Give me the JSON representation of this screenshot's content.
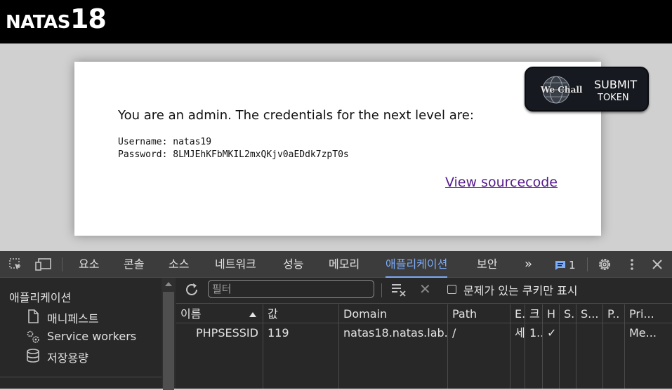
{
  "page": {
    "brand_text": "NATAS",
    "brand_num": "18",
    "message": "You are an admin. The credentials for the next level are:",
    "username_line": "Username: natas19",
    "password_line": "Password: 8LMJEhKFbMKIL2mxQKjv0aEDdk7zpT0s",
    "source_link": "View sourcecode",
    "submit_token": {
      "logo_text": "We Chall",
      "line1": "SUBMIT",
      "line2": "TOKEN"
    }
  },
  "devtools": {
    "tabs": [
      "요소",
      "콘솔",
      "소스",
      "네트워크",
      "성능",
      "메모리",
      "애플리케이션",
      "보안"
    ],
    "active_tab": "애플리케이션",
    "more": "»",
    "issues_count": "1",
    "sidebar": {
      "title": "애플리케이션",
      "items": [
        {
          "label": "매니페스트",
          "icon": "file-icon"
        },
        {
          "label": "Service workers",
          "icon": "gears-icon"
        },
        {
          "label": "저장용량",
          "icon": "database-icon"
        }
      ]
    },
    "filter": {
      "placeholder": "필터",
      "only_issues_label": "문제가 있는 쿠키만 표시"
    },
    "table": {
      "headers": [
        "이름",
        "값",
        "Domain",
        "Path",
        "E.",
        "크",
        "H",
        "S.",
        "S...",
        "P..",
        "Pri..."
      ],
      "rows": [
        [
          "PHPSESSID",
          "119",
          "natas18.natas.lab...",
          "/",
          "세",
          "1..",
          "✓",
          "",
          "",
          "",
          "Me..."
        ]
      ]
    },
    "colors": {
      "accent": "#7cacf8",
      "toolbar_bg": "#3c3c3c",
      "panel_bg": "#282828"
    }
  }
}
